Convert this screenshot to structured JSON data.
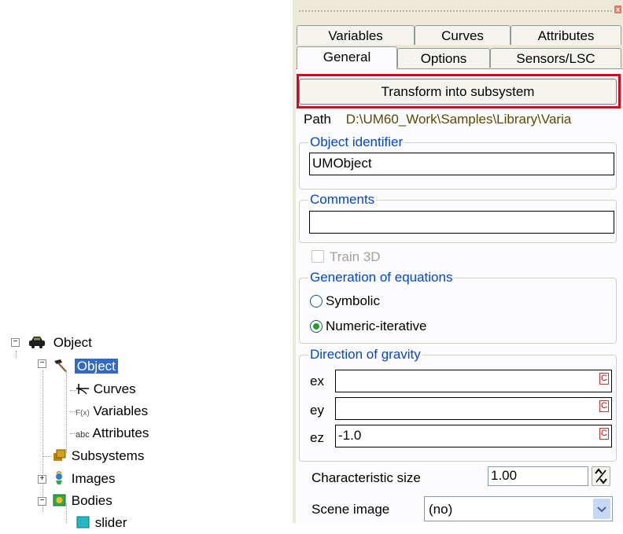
{
  "tree": {
    "root": "Object",
    "object_node": "Object",
    "children": [
      "Curves",
      "Variables",
      "Attributes",
      "Subsystems",
      "Images",
      "Bodies",
      "slider"
    ],
    "icon_labels": {
      "variables_prefix": "F(x)",
      "attributes_prefix": "abc"
    }
  },
  "panel": {
    "tabs_row1": [
      "Variables",
      "Curves",
      "Attributes"
    ],
    "tabs_row2": [
      "General",
      "Options",
      "Sensors/LSC"
    ],
    "active_tab": "General",
    "transform_button": "Transform into subsystem",
    "path_label": "Path",
    "path_value": "D:\\UM60_Work\\Samples\\Library\\Varia",
    "object_identifier_label": "Object identifier",
    "object_identifier_value": "UMObject",
    "comments_label": "Comments",
    "comments_value": "",
    "train3d_label": "Train 3D",
    "equations_label": "Generation of equations",
    "radio_symbolic": "Symbolic",
    "radio_numeric": "Numeric-iterative",
    "selected_equation": "Numeric-iterative",
    "gravity_label": "Direction of gravity",
    "ex_label": "ex",
    "ey_label": "ey",
    "ez_label": "ez",
    "ex_value": "",
    "ey_value": "",
    "ez_value": "-1.0",
    "c_icon": "C",
    "char_size_label": "Characteristic size",
    "char_size_value": "1.00",
    "scene_image_label": "Scene image",
    "scene_image_value": "(no)"
  },
  "colors": {
    "highlight": "#e2001a",
    "selection": "#3169c6",
    "group_label": "#0046d5",
    "path_text": "#5a4a00"
  }
}
